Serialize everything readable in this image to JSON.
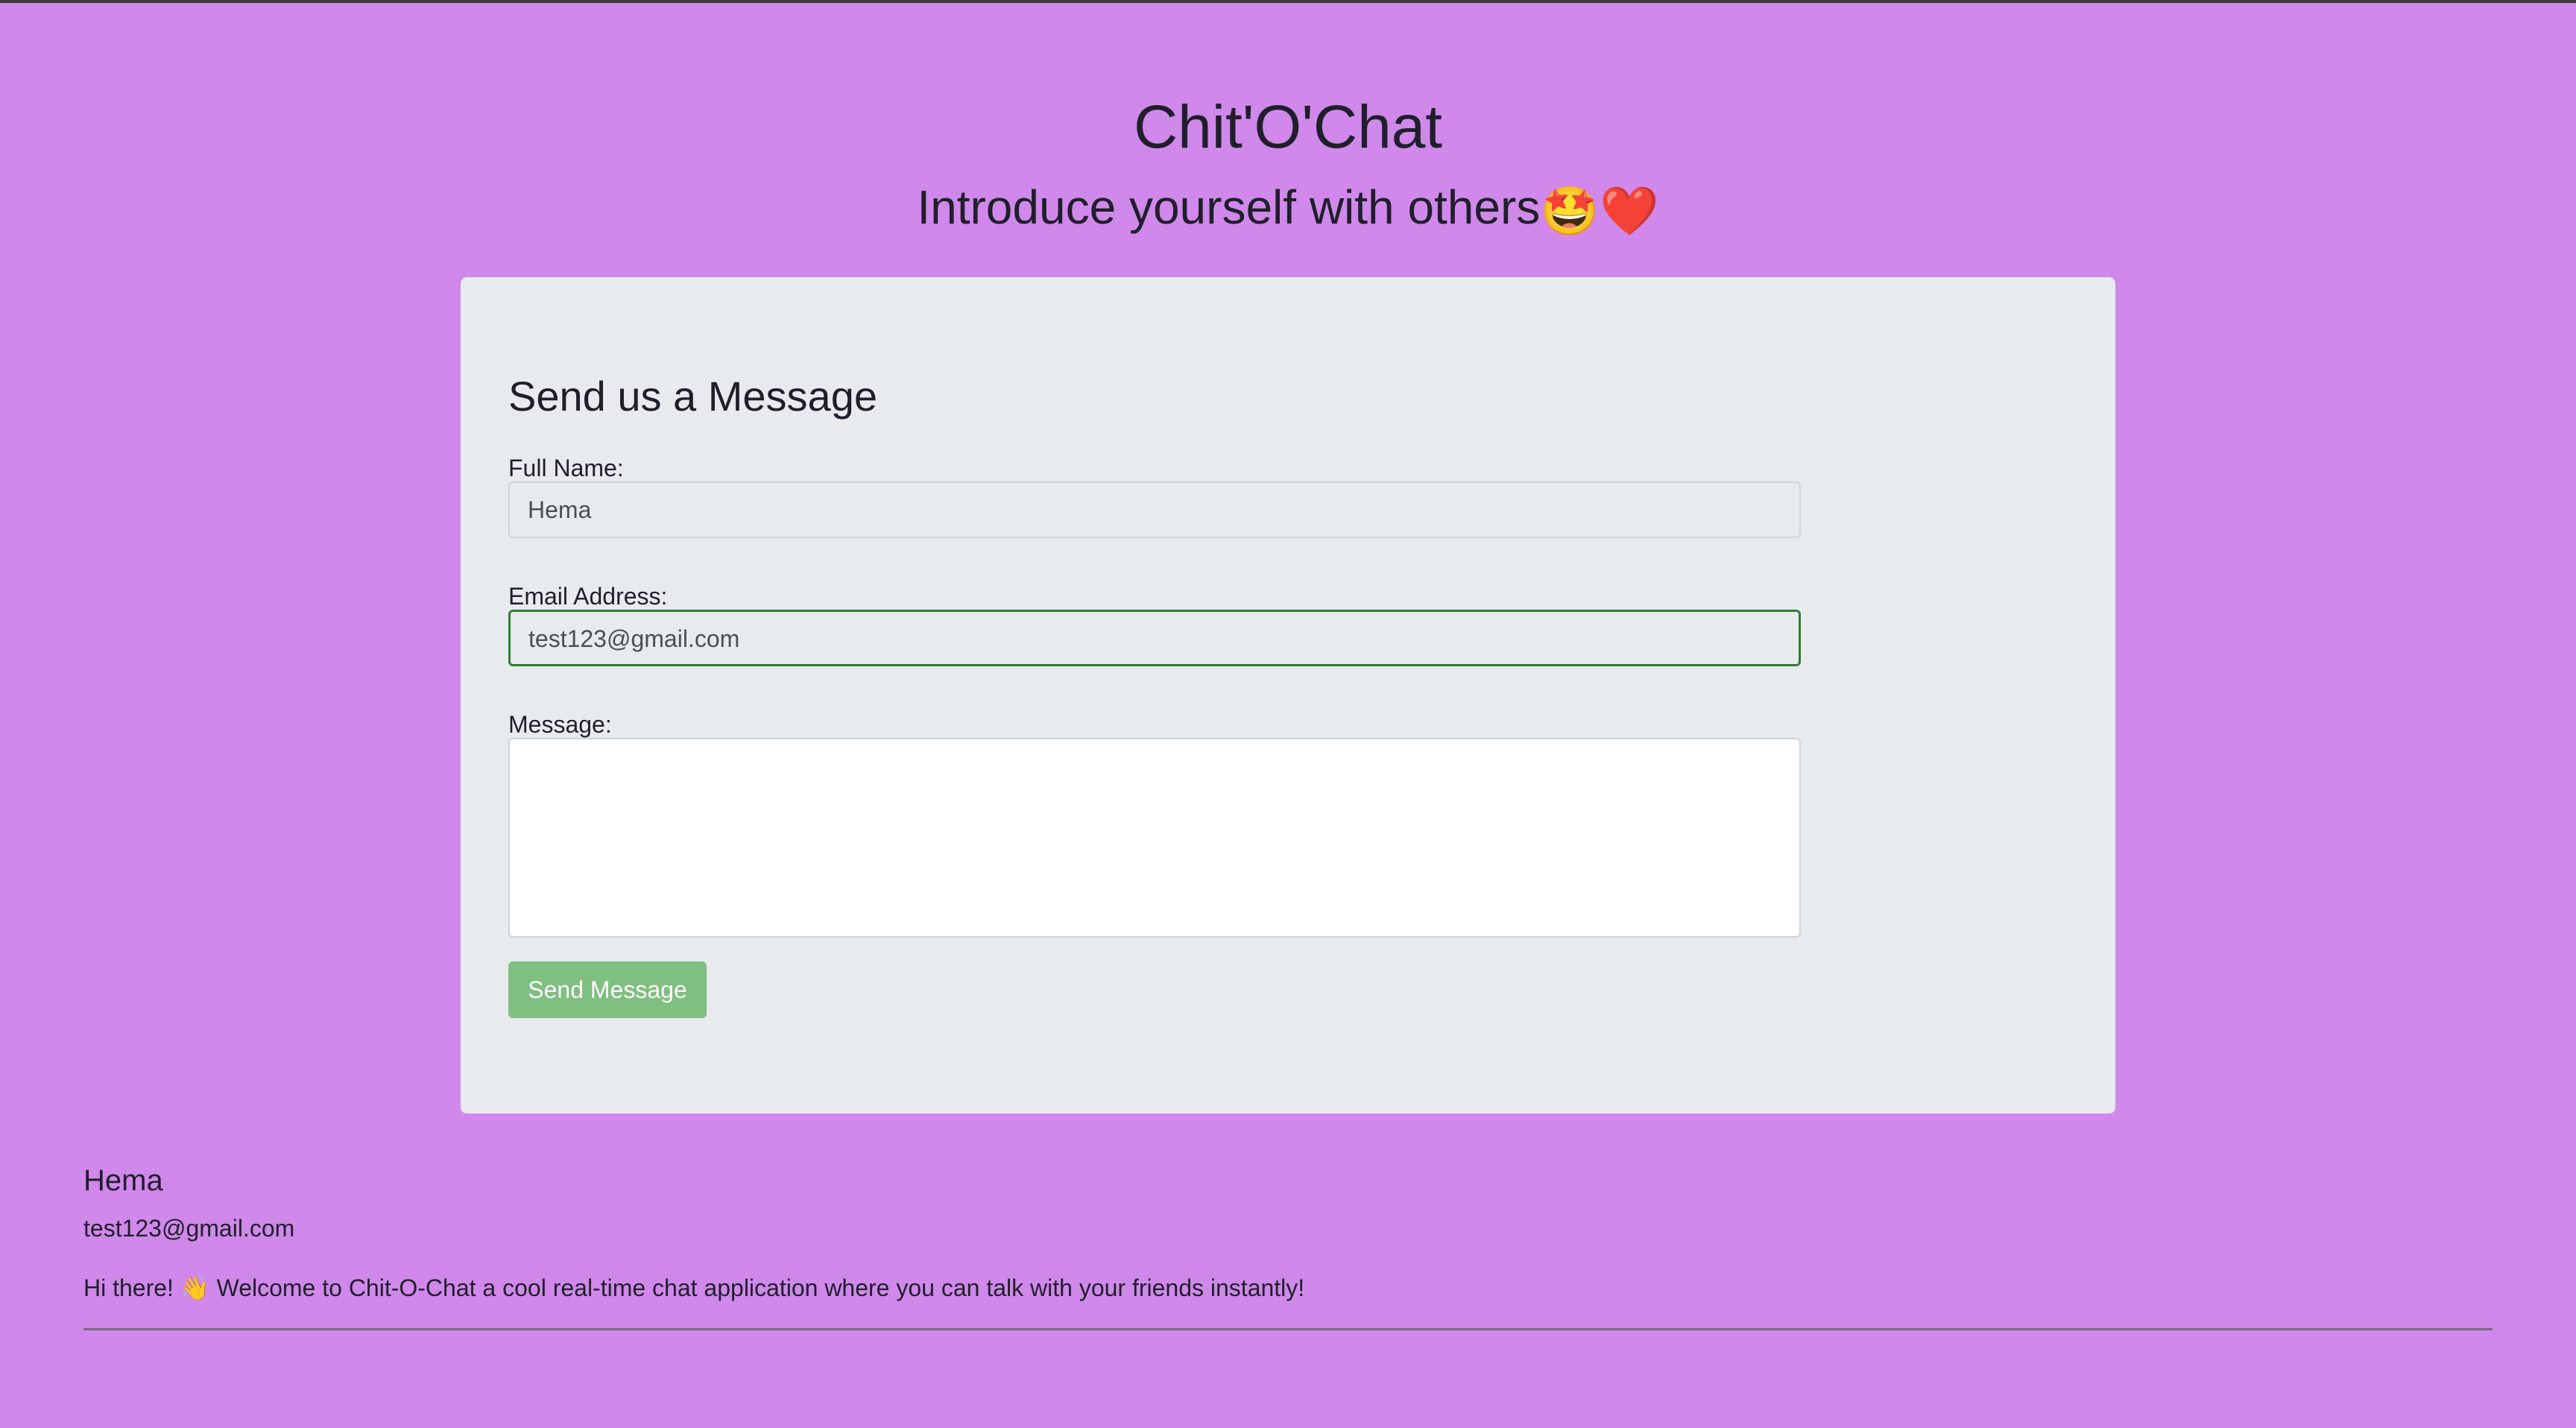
{
  "header": {
    "title": "Chit'O'Chat",
    "subtitle": "Introduce yourself with others",
    "subtitle_emojis": "🤩❤️"
  },
  "form": {
    "title": "Send us a Message",
    "name_label": "Full Name:",
    "name_value": "Hema",
    "email_label": "Email Address:",
    "email_value": "test123@gmail.com",
    "message_label": "Message:",
    "message_value": "",
    "send_label": "Send Message"
  },
  "entries": [
    {
      "name": "Hema",
      "email": "test123@gmail.com",
      "message": "Hi there! 👋 Welcome to Chit-O-Chat a cool real-time chat application where you can talk with your friends instantly!"
    }
  ],
  "colors": {
    "background": "#d088ea",
    "card": "#e8ebee",
    "focus_border": "#2e7d32",
    "button": "#7fbf7f"
  }
}
